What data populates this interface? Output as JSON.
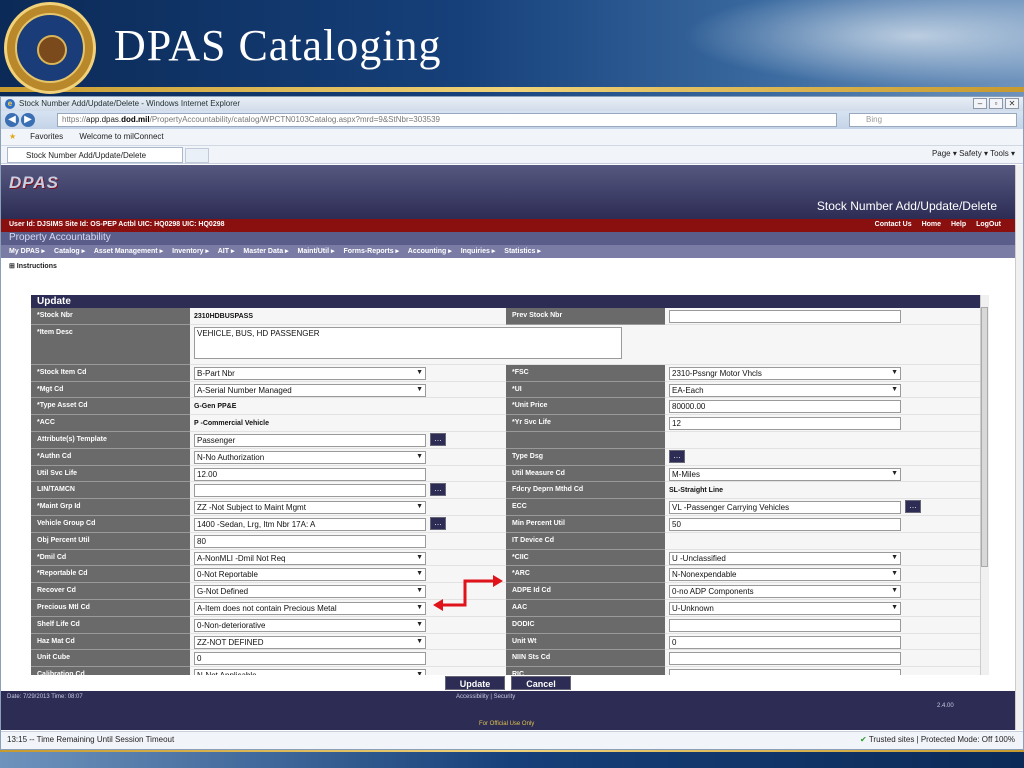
{
  "slide": {
    "title": "DPAS Cataloging"
  },
  "browser": {
    "window_title": "Stock Number Add/Update/Delete - Windows Internet Explorer",
    "url_scheme": "https://",
    "url_host": "app.dpas.",
    "url_domain": "dod.mil",
    "url_path": "/PropertyAccountability/catalog/WPCTN0103Catalog.aspx?mrd=9&StNbr=303539",
    "search_placeholder": "Bing",
    "favorites": [
      "Favorites",
      "Welcome to milConnect"
    ],
    "tab_label": "Stock Number Add/Update/Delete",
    "command_bar": "Page ▾  Safety ▾  Tools ▾",
    "status_left": "13:15 -- Time Remaining Until Session Timeout",
    "status_zone": "Trusted sites | Protected Mode: Off",
    "zoom": "100%"
  },
  "app": {
    "logo": "DPAS",
    "heading": "Stock Number Add/Update/Delete",
    "user_line": "User Id: DJSIMS   Site Id: OS-PEP   Actbl UIC: HQ0298   UIC: HQ0298",
    "top_links": [
      "Contact Us",
      "Home",
      "Help",
      "LogOut"
    ],
    "module": "Property Accountability",
    "menu": [
      "My DPAS ▸",
      "Catalog ▸",
      "Asset Management ▸",
      "Inventory ▸",
      "AIT ▸",
      "Master Data ▸",
      "Maint/Util ▸",
      "Forms-Reports ▸",
      "Accounting ▸",
      "Inquiries ▸",
      "Statistics ▸"
    ],
    "instructions": "⊞ Instructions",
    "panel_title": "Update",
    "buttons": {
      "update": "Update",
      "cancel": "Cancel"
    },
    "footer_date": "Date: 7/29/2013 Time: 08:07",
    "footer_links": "Accessibility | Security",
    "footer_version": "2.4.00",
    "footer_fouo": "For Official Use Only"
  },
  "form": {
    "stock_nbr": {
      "label": "*Stock Nbr",
      "value": "2310HDBUSPASS"
    },
    "prev_stock_nbr": {
      "label": "Prev Stock Nbr",
      "value": ""
    },
    "item_desc": {
      "label": "*Item Desc",
      "value": "VEHICLE, BUS, HD PASSENGER"
    },
    "rows": [
      {
        "l1": "*Stock Item Cd",
        "v1": "B-Part Nbr",
        "t1": "sel",
        "l2": "*FSC",
        "v2": "2310-Pssngr Motor Vhcls",
        "t2": "sel"
      },
      {
        "l1": "*Mgt Cd",
        "v1": "A-Serial Number Managed",
        "t1": "sel",
        "l2": "*UI",
        "v2": "EA-Each",
        "t2": "sel"
      },
      {
        "l1": "*Type Asset Cd",
        "v1": "G-Gen PP&E",
        "t1": "ro",
        "l2": "*Unit Price",
        "v2": "80000.00",
        "t2": "txt"
      },
      {
        "l1": "*ACC",
        "v1": "P -Commercial Vehicle",
        "t1": "ro",
        "l2": "*Yr Svc Life",
        "v2": "12",
        "t2": "txt"
      },
      {
        "l1": "Attribute(s) Template",
        "v1": "Passenger",
        "t1": "txtbtn",
        "l2": "",
        "v2": "",
        "t2": "blank"
      },
      {
        "l1": "*Authn Cd",
        "v1": "N-No Authorization",
        "t1": "sel",
        "l2": "Type Dsg",
        "v2": "",
        "t2": "btn"
      },
      {
        "l1": "Util Svc Life",
        "v1": "12.00",
        "t1": "txt",
        "l2": "Util Measure Cd",
        "v2": "M-Miles",
        "t2": "sel"
      },
      {
        "l1": "LIN/TAMCN",
        "v1": "",
        "t1": "txtbtn",
        "l2": "Fdcry Deprn Mthd Cd",
        "v2": "SL-Straight Line",
        "t2": "ro"
      },
      {
        "l1": "*Maint Grp Id",
        "v1": "ZZ -Not Subject to Maint Mgmt",
        "t1": "sel",
        "l2": "ECC",
        "v2": "VL -Passenger Carrying Vehicles",
        "t2": "txtbtn"
      },
      {
        "l1": "Vehicle Group Cd",
        "v1": "1400 -Sedan, Lrg, Itm Nbr 17A: A",
        "t1": "txtbtn",
        "l2": "Min Percent Util",
        "v2": "50",
        "t2": "txt"
      },
      {
        "l1": "Obj Percent Util",
        "v1": "80",
        "t1": "txt",
        "l2": "IT Device Cd",
        "v2": "",
        "t2": "blank"
      },
      {
        "l1": "*Dmil Cd",
        "v1": "A-NonMLI -Dmil Not Req",
        "t1": "sel",
        "l2": "*CIIC",
        "v2": "U -Unclassified",
        "t2": "sel"
      },
      {
        "l1": "*Reportable Cd",
        "v1": "0-Not Reportable",
        "t1": "sel",
        "l2": "*ARC",
        "v2": "N-Nonexpendable",
        "t2": "sel"
      },
      {
        "l1": "Recover Cd",
        "v1": "G-Not Defined",
        "t1": "sel",
        "l2": "ADPE Id Cd",
        "v2": "0-no ADP Components",
        "t2": "sel"
      },
      {
        "l1": "Precious Mtl Cd",
        "v1": "A-Item does not contain Precious Metal",
        "t1": "sel",
        "l2": "AAC",
        "v2": "U-Unknown",
        "t2": "sel"
      },
      {
        "l1": "Shelf Life Cd",
        "v1": "0-Non-deteriorative",
        "t1": "sel",
        "l2": "DODIC",
        "v2": "",
        "t2": "txt"
      },
      {
        "l1": "Haz Mat Cd",
        "v1": "ZZ-NOT DEFINED",
        "t1": "sel",
        "l2": "Unit Wt",
        "v2": "0",
        "t2": "txt"
      },
      {
        "l1": "Unit Cube",
        "v1": "0",
        "t1": "txt",
        "l2": "NIIN Sts Cd",
        "v2": "",
        "t2": "txt"
      },
      {
        "l1": "Calibration Cd",
        "v1": "N-Not Applicable",
        "t1": "sel",
        "l2": "RIC",
        "v2": "",
        "t2": "txt"
      }
    ]
  },
  "colors": {
    "header": "#2c2c55",
    "userbar": "#8a1010",
    "label_bg": "#6a6a6a",
    "arrow": "#e0121a"
  }
}
